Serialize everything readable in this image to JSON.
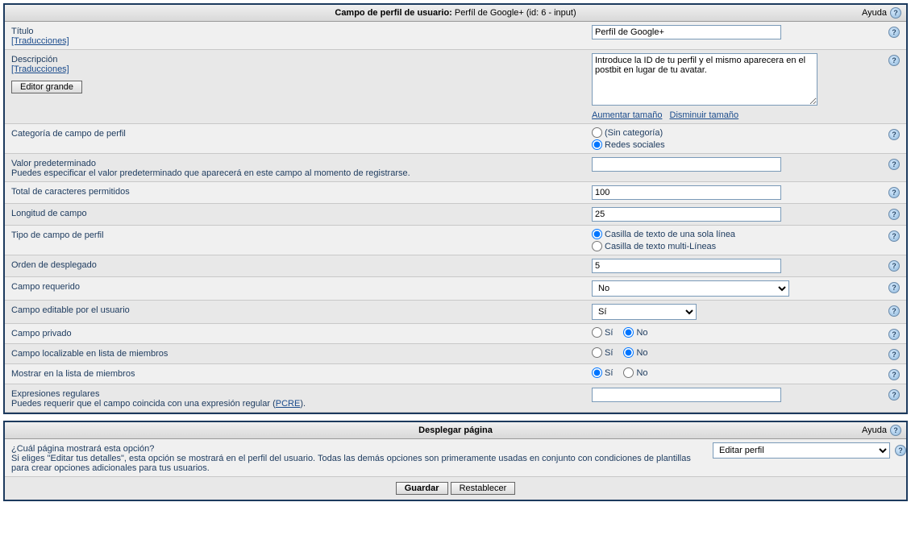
{
  "panel1": {
    "title_label": "Campo de perfil de usuario:",
    "title_value": "Perfíl de Google+ (id: 6 - input)",
    "help_label": "Ayuda"
  },
  "fields": {
    "titulo": {
      "label": "Título",
      "translations": "[Traducciones]",
      "value": "Perfíl de Google+"
    },
    "descripcion": {
      "label": "Descripción",
      "translations": "[Traducciones]",
      "editor_btn": "Editor grande",
      "value": "Introduce la ID de tu perfil y el mismo aparecera en el postbit en lugar de tu avatar.",
      "increase": "Aumentar tamaño",
      "decrease": "Disminuir tamaño"
    },
    "categoria": {
      "label": "Categoría de campo de perfil",
      "opt_none": "(Sin categoría)",
      "opt_redes": "Redes sociales"
    },
    "default": {
      "label": "Valor predeterminado",
      "hint": "Puedes especificar el valor predeterminado que aparecerá en este campo al momento de registrarse.",
      "value": ""
    },
    "maxchars": {
      "label": "Total de caracteres permitidos",
      "value": "100"
    },
    "longitud": {
      "label": "Longitud de campo",
      "value": "25"
    },
    "tipo": {
      "label": "Tipo de campo de perfil",
      "opt_single": "Casilla de texto de una sola línea",
      "opt_multi": "Casilla de texto multi-Líneas"
    },
    "orden": {
      "label": "Orden de desplegado",
      "value": "5"
    },
    "requerido": {
      "label": "Campo requerido",
      "value": "No"
    },
    "editable": {
      "label": "Campo editable por el usuario",
      "value": "Sí"
    },
    "privado": {
      "label": "Campo privado",
      "yes": "Sí",
      "no": "No"
    },
    "localizable": {
      "label": "Campo localizable en lista de miembros",
      "yes": "Sí",
      "no": "No"
    },
    "mostrar": {
      "label": "Mostrar en la lista de miembros",
      "yes": "Sí",
      "no": "No"
    },
    "regex": {
      "label": "Expresiones regulares",
      "hint_pre": "Puedes requerir que el campo coincida con una expresión regular (",
      "pcre": "PCRE",
      "hint_post": ").",
      "value": ""
    }
  },
  "panel2": {
    "title": "Desplegar página",
    "help_label": "Ayuda",
    "question": "¿Cuál página mostrará esta opción?",
    "hint": "Si eliges \"Editar tus detalles\", esta opción se mostrará en el perfil del usuario. Todas las demás opciones son primeramente usadas en conjunto con condiciones de plantillas para crear opciones adicionales para tus usuarios.",
    "select_value": "Editar perfil"
  },
  "buttons": {
    "save": "Guardar",
    "reset": "Restablecer"
  }
}
